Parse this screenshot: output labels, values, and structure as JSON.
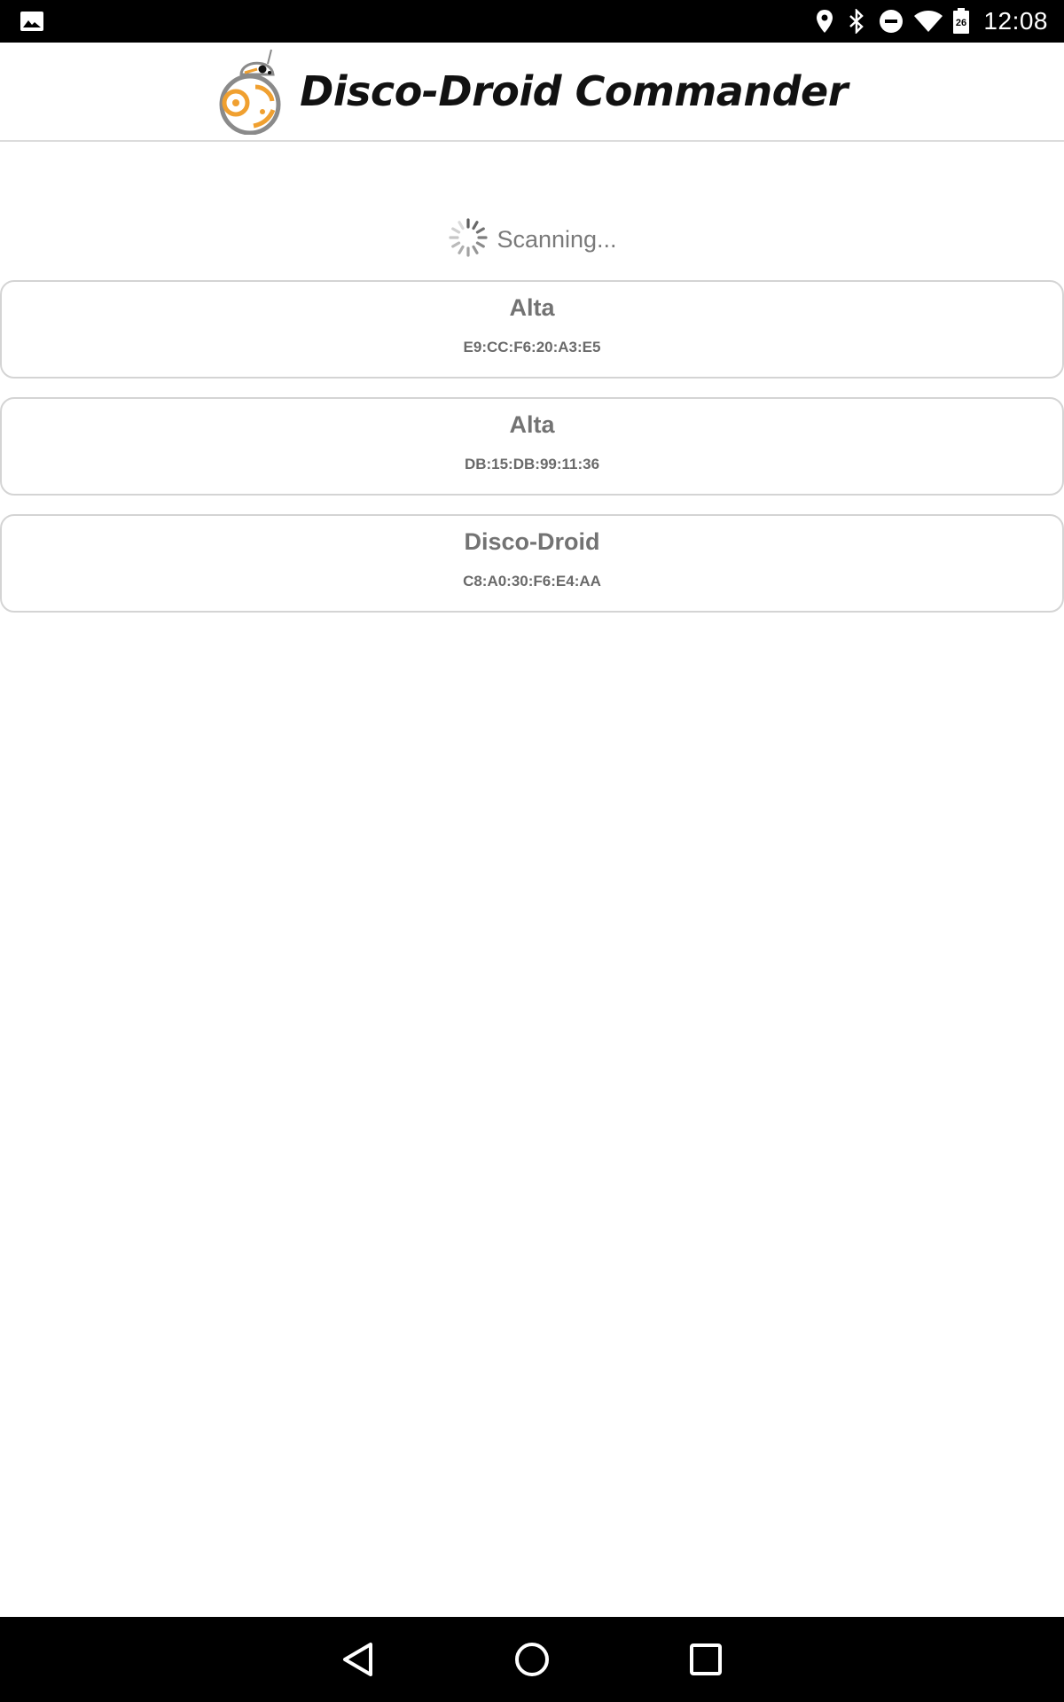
{
  "status_bar": {
    "time": "12:08",
    "battery_level": "26",
    "icons": [
      "image-notification-icon",
      "location-icon",
      "bluetooth-icon",
      "do-not-disturb-icon",
      "wifi-icon",
      "battery-icon"
    ]
  },
  "header": {
    "title": "Disco-Droid Commander",
    "logo": "bb8-droid-logo"
  },
  "scan": {
    "status_text": "Scanning..."
  },
  "devices": [
    {
      "name": "Alta",
      "mac": "E9:CC:F6:20:A3:E5"
    },
    {
      "name": "Alta",
      "mac": "DB:15:DB:99:11:36"
    },
    {
      "name": "Disco-Droid",
      "mac": "C8:A0:30:F6:E4:AA"
    }
  ],
  "nav_bar": {
    "buttons": [
      "back-icon",
      "home-icon",
      "recents-icon"
    ]
  },
  "colors": {
    "status_bar_bg": "#000000",
    "droid_orange": "#f0a030",
    "card_border": "#d4d4d4",
    "text_gray": "#737373"
  }
}
